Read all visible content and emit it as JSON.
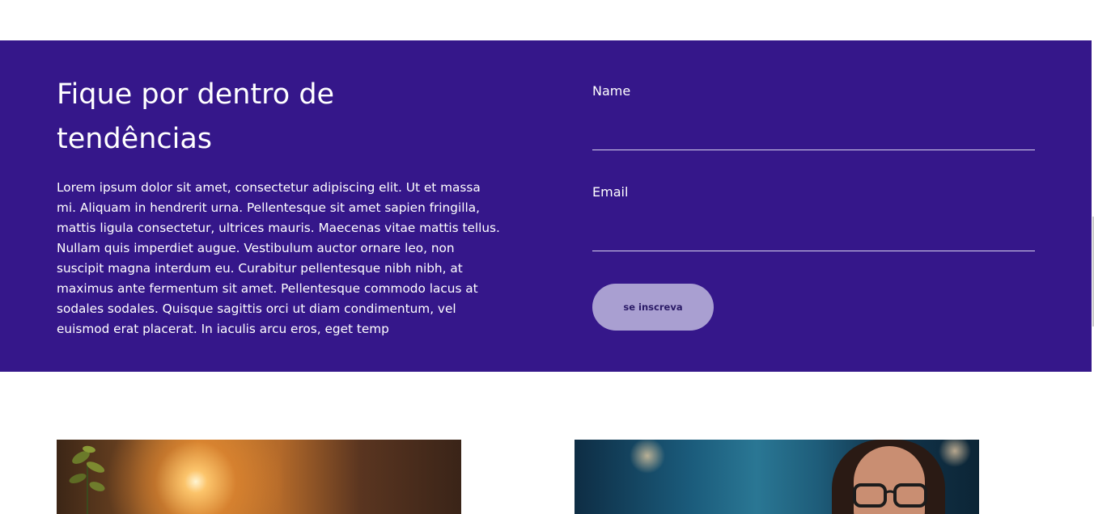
{
  "newsletter": {
    "title": "Fique por dentro de tendências",
    "body": "Lorem ipsum dolor sit amet, consectetur adipiscing elit. Ut et massa mi. Aliquam in hendrerit urna. Pellentesque sit amet sapien fringilla, mattis ligula consectetur, ultrices mauris. Maecenas vitae mattis tellus. Nullam quis imperdiet augue. Vestibulum auctor ornare leo, non suscipit magna interdum eu. Curabitur pellentesque nibh nibh, at maximus ante fermentum sit amet. Pellentesque commodo lacus at sodales sodales. Quisque sagittis orci ut diam condimentum, vel euismod erat placerat. In iaculis arcu eros, eget temp",
    "form": {
      "name_label": "Name",
      "name_value": "",
      "email_label": "Email",
      "email_value": "",
      "submit_label": "se inscreva"
    }
  },
  "colors": {
    "section_bg": "#35178a",
    "button_bg": "#a99fd1",
    "button_text": "#2a1a66"
  },
  "cards": [
    {
      "image": "person-working-sunset-photo"
    },
    {
      "image": "woman-with-glasses-photo"
    }
  ]
}
